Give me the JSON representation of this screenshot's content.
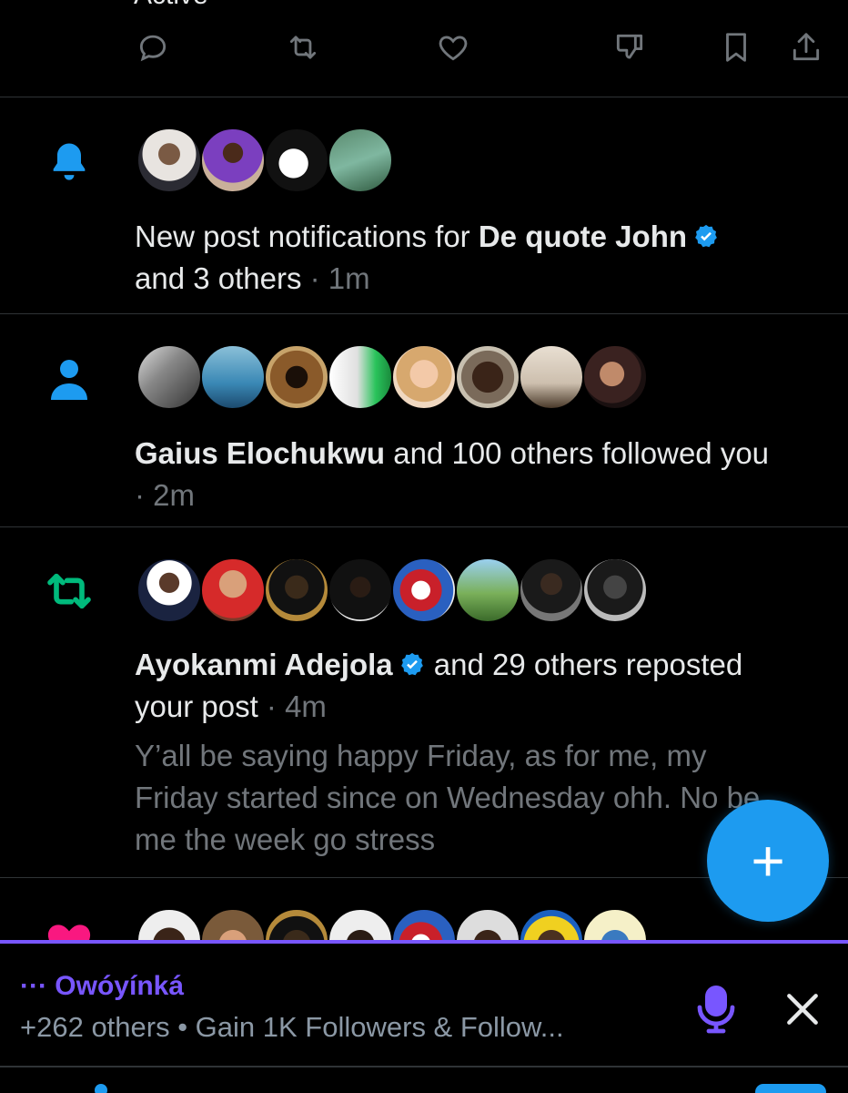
{
  "top_partial_text": "Active",
  "action_bar": {
    "icons": [
      "reply-icon",
      "repost-icon",
      "like-icon",
      "downvote-icon",
      "bookmark-icon",
      "share-icon"
    ]
  },
  "notifications": [
    {
      "type": "bell",
      "icon_color": "#1d9bf0",
      "prefix": "New post notifications for ",
      "name": "De quote John",
      "verified": true,
      "suffix": "and 3 others",
      "time": " · 1m",
      "avatar_count": 4
    },
    {
      "type": "follow",
      "icon_color": "#1d9bf0",
      "name": "Gaius Elochukwu",
      "suffix": " and 100 others followed you",
      "time": "· 2m",
      "avatar_count": 8
    },
    {
      "type": "repost",
      "icon_color": "#00ba7c",
      "name": "Ayokanmi Adejola",
      "verified": true,
      "suffix": " and 29 others reposted",
      "suffix2": "your post",
      "time": " · 4m",
      "quote_lines": [
        "Y’all be saying happy Friday, as for me, my",
        "Friday started since on Wednesday ohh. No be",
        "me the week go stress"
      ],
      "avatar_count": 8
    },
    {
      "type": "like",
      "icon_color": "#f91880",
      "avatar_count": 8
    }
  ],
  "fab": {
    "label": "+"
  },
  "spaces": {
    "title": "··· Owóyínká",
    "subtitle": "+262 others • Gain 1K Followers & Follow...",
    "accent": "#7856ff"
  },
  "colors": {
    "background": "#000000",
    "text": "#e7e9ea",
    "muted": "#71767b",
    "accent_blue": "#1d9bf0",
    "repost_green": "#00ba7c",
    "like_pink": "#f91880"
  }
}
